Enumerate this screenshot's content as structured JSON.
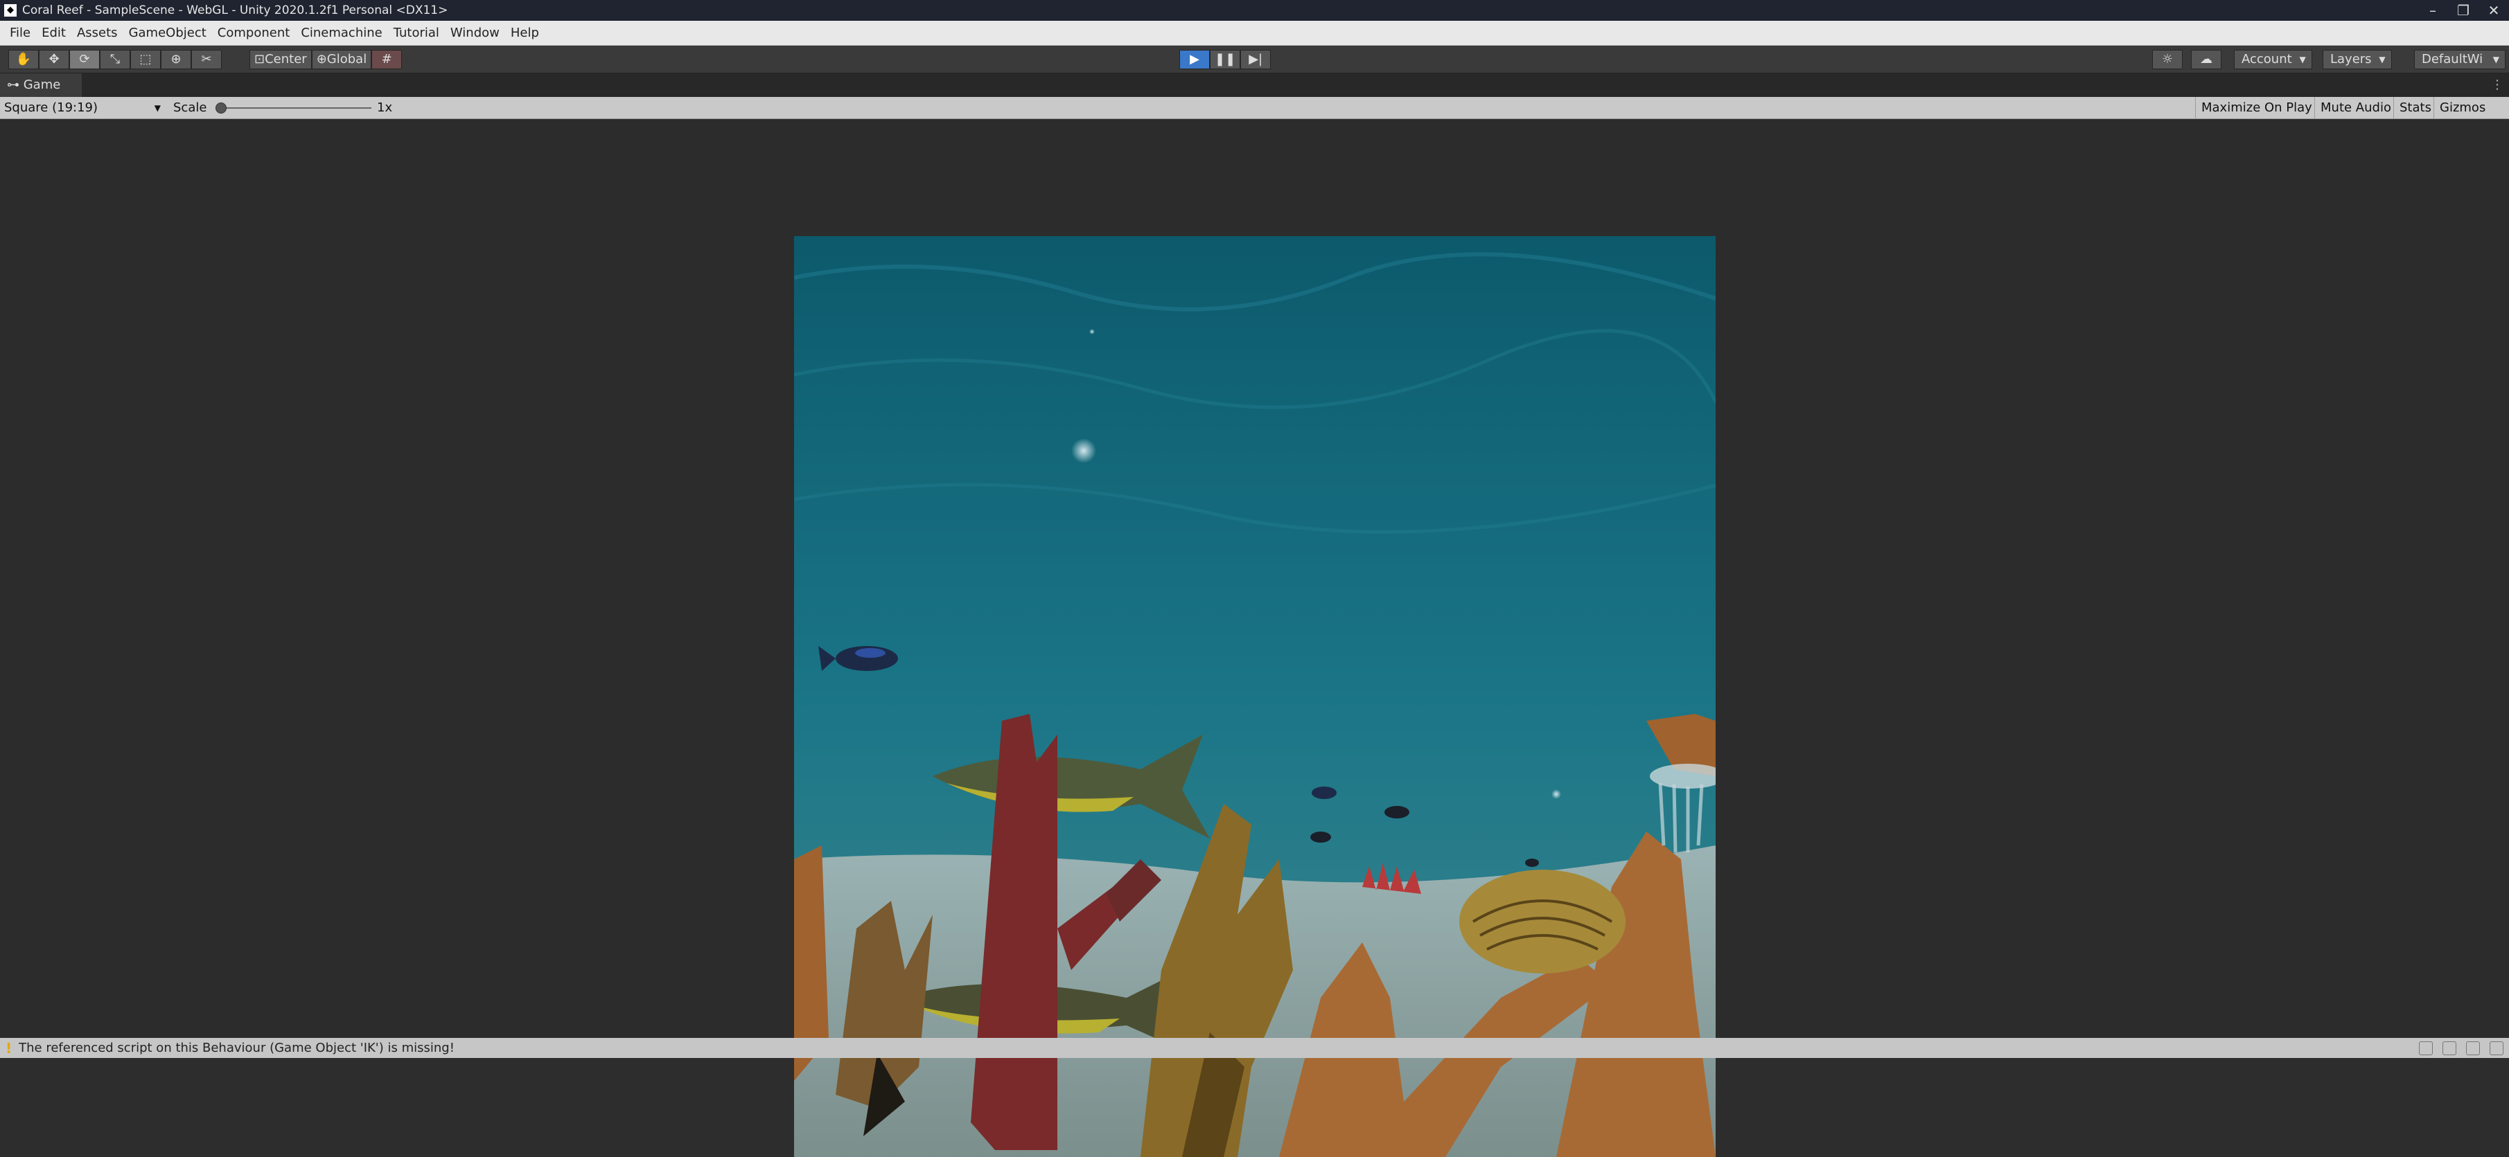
{
  "window": {
    "title": "Coral Reef - SampleScene - WebGL - Unity 2020.1.2f1 Personal <DX11>",
    "controls": [
      "–",
      "❐",
      "✕"
    ]
  },
  "menu": [
    "File",
    "Edit",
    "Assets",
    "GameObject",
    "Component",
    "Cinemachine",
    "Tutorial",
    "Window",
    "Help"
  ],
  "toolbar": {
    "tools": [
      "hand-icon",
      "move-icon",
      "rotate-icon",
      "scale-icon",
      "rect-icon",
      "transform-icon",
      "custom-tool-icon"
    ],
    "pivot_mode": "Center",
    "pivot_rotation": "Global",
    "play": "▶",
    "pause": "❚❚",
    "step": "▶|",
    "account": "Account",
    "layers": "Layers",
    "layout": "DefaultWi"
  },
  "game_tab": {
    "label": "Game"
  },
  "game_bar": {
    "aspect": "Square (19:19)",
    "scale_label": "Scale",
    "scale_value": "1x",
    "maximize": "Maximize On Play",
    "mute": "Mute Audio",
    "stats": "Stats",
    "gizmos": "Gizmos"
  },
  "status": {
    "message": "The referenced script on this Behaviour (Game Object 'IK') is missing!"
  },
  "colors": {
    "water_top": "#0d5c6e",
    "water_mid": "#1a7b8c",
    "sand": "#8fa6a5",
    "coral_red": "#7a2a2a",
    "coral_orange": "#a86a35",
    "play_blue": "#3a78c9"
  }
}
